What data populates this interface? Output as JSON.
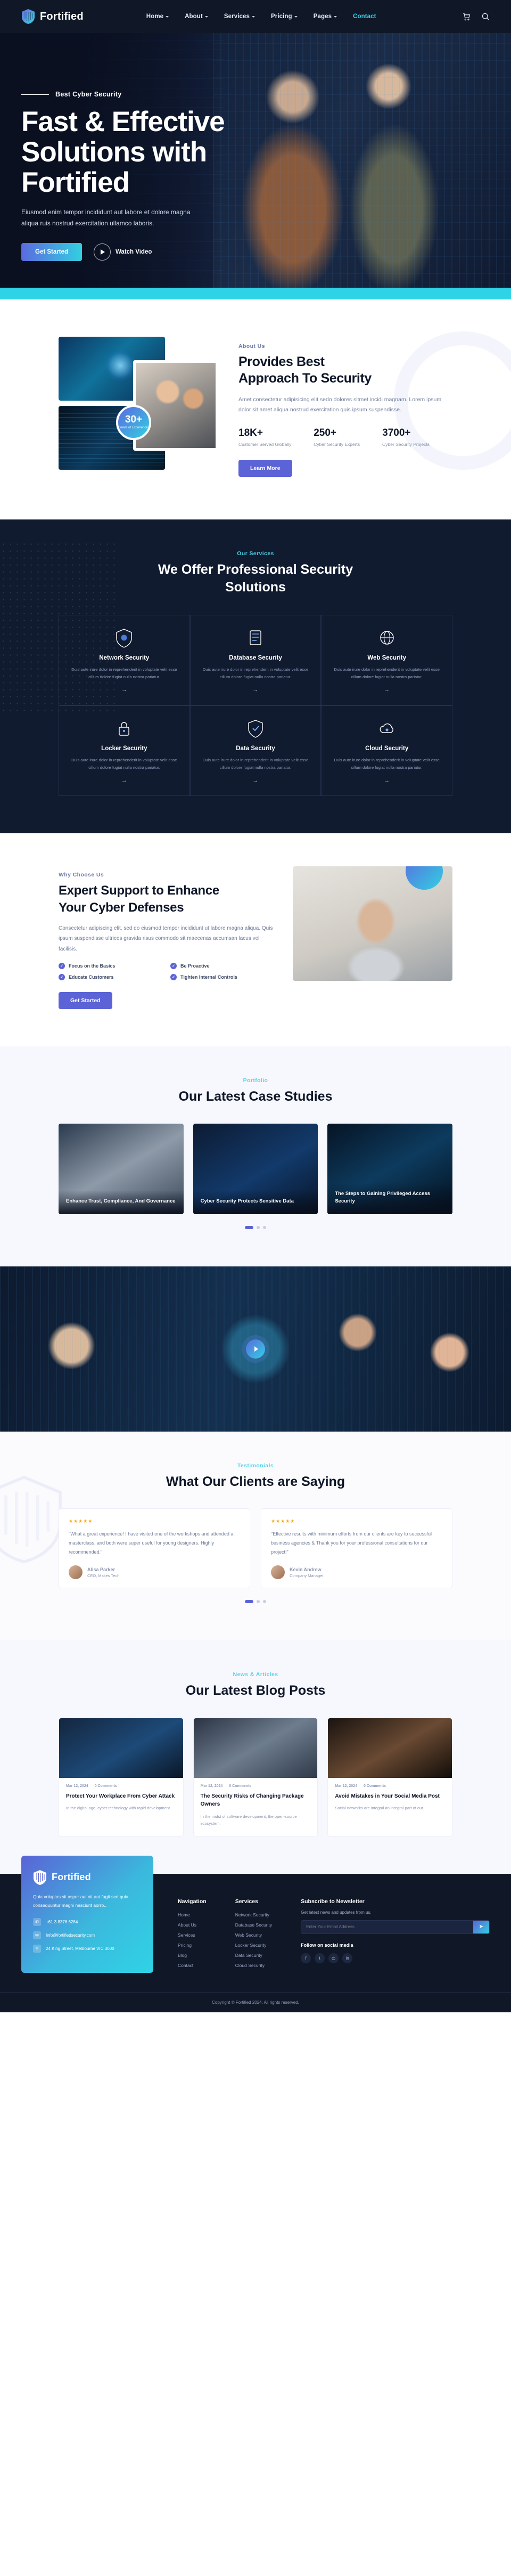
{
  "brand": {
    "name": "Fortified"
  },
  "nav": {
    "items": [
      {
        "label": "Home",
        "caret": true,
        "active": false
      },
      {
        "label": "About",
        "caret": true,
        "active": false
      },
      {
        "label": "Services",
        "caret": true,
        "active": false
      },
      {
        "label": "Pricing",
        "caret": true,
        "active": false
      },
      {
        "label": "Pages",
        "caret": true,
        "active": false
      },
      {
        "label": "Contact",
        "caret": false,
        "active": true
      }
    ],
    "icons": [
      "cart-icon",
      "search-icon"
    ]
  },
  "hero": {
    "eyebrow": "Best Cyber Security",
    "title_line1": "Fast & Effective",
    "title_line2": "Solutions with",
    "title_line3": "Fortified",
    "paragraph": "Eiusmod enim tempor incididunt aut labore et dolore magna aliqua ruis nostrud exercitation ullamco laboris.",
    "cta_primary": "Get Started",
    "cta_secondary": "Watch Video"
  },
  "about": {
    "badge_number": "30+",
    "badge_text": "Years of Experience",
    "tagline": "About Us",
    "heading_line1": "Provides Best",
    "heading_line2": "Approach To Security",
    "paragraph": "Amet consectetur adipisicing elit sedo dolores sitmet incidi magnam. Lorem ipsum dolor sit amet aliqua nostrud exercitation quis ipsum suspendisse.",
    "stats": [
      {
        "value": "18K+",
        "label": "Customer Served Globally"
      },
      {
        "value": "250+",
        "label": "Cyber Security Experts"
      },
      {
        "value": "3700+",
        "label": "Cyber Security Projects"
      }
    ],
    "cta": "Learn More"
  },
  "services": {
    "tagline": "Our Services",
    "heading_line1": "We Offer Professional Security",
    "heading_line2": "Solutions",
    "cards": [
      {
        "icon": "shield-lock-icon",
        "title": "Network Security",
        "text": "Duis aute irure dolor in reprehenderit in voluptate velit esse cillum dolore fugiat nulla nostra pariatur.",
        "arrow": "→"
      },
      {
        "icon": "database-icon",
        "title": "Database Security",
        "text": "Duis aute irure dolor in reprehenderit in voluptate velit esse cillum dolore fugiat nulla nostra pariatur.",
        "arrow": "→"
      },
      {
        "icon": "globe-icon",
        "title": "Web Security",
        "text": "Duis aute irure dolor in reprehenderit in voluptate velit esse cillum dolore fugiat nulla nostra pariatur.",
        "arrow": "→"
      },
      {
        "icon": "locker-icon",
        "title": "Locker Security",
        "text": "Duis aute irure dolor in reprehenderit in voluptate velit esse cillum dolore fugiat nulla nostra pariatur.",
        "arrow": "→"
      },
      {
        "icon": "data-shield-icon",
        "title": "Data Security",
        "text": "Duis aute irure dolor in reprehenderit in voluptate velit esse cillum dolore fugiat nulla nostra pariatur.",
        "arrow": "→"
      },
      {
        "icon": "cloud-icon",
        "title": "Cloud Security",
        "text": "Duis aute irure dolor in reprehenderit in voluptate velit esse cillum dolore fugiat nulla nostra pariatur.",
        "arrow": "→"
      }
    ]
  },
  "expert": {
    "tagline": "Why Choose Us",
    "heading_line1": "Expert Support to Enhance",
    "heading_line2": "Your Cyber Defenses",
    "paragraph": "Consectetur adipiscing elit, sed do eiusmod tempor incididunt ut labore magna aliqua. Quis ipsum suspendisse ultrices gravida risus commodo sit maecenas accumsan lacus vel facilisis.",
    "checks": [
      "Focus on the Basics",
      "Be Proactive",
      "Educate Customers",
      "Tighten Internal Controls"
    ],
    "cta": "Get Started"
  },
  "cases": {
    "tagline": "Portfolio",
    "heading": "Our Latest Case Studies",
    "items": [
      {
        "title": "Enhance Trust, Compliance, And Governance"
      },
      {
        "title": "Cyber Security Protects Sensitive Data"
      },
      {
        "title": "The Steps to Gaining Privileged Access Security"
      }
    ],
    "dots": 3,
    "active_dot": 1
  },
  "testimonials": {
    "tagline": "Testimonials",
    "heading": "What Our Clients are Saying",
    "items": [
      {
        "stars": "★★★★★",
        "quote": "\"What a great experience! I have visited one of the workshops and attended a masterclass, and both were super useful for young designers. Highly recommended.\"",
        "name": "Alisa Parker",
        "role": "CEO, Makes Tech"
      },
      {
        "stars": "★★★★★",
        "quote": "\"Effective results with minimum efforts from our clients are key to successful business agencies & Thank you for your professional consultations for our project!\"",
        "name": "Kevin Andrew",
        "role": "Company Manager"
      }
    ],
    "dots": 3,
    "active_dot": 1
  },
  "blog": {
    "tagline": "News & Articles",
    "heading": "Our Latest Blog Posts",
    "posts": [
      {
        "date": "Mar 12, 2024",
        "comments": "0 Comments",
        "title": "Protect Your Workplace From Cyber Attack",
        "excerpt": "In the digital age, cyber technology with rapid development."
      },
      {
        "date": "Mar 12, 2024",
        "comments": "0 Comments",
        "title": "The Security Risks of Changing Package Owners",
        "excerpt": "In the midst of software development, the open-source ecosystem."
      },
      {
        "date": "Mar 12, 2024",
        "comments": "0 Comments",
        "title": "Avoid Mistakes in Your Social Media Post",
        "excerpt": "Social networks are integral an integral part of our."
      }
    ]
  },
  "footer": {
    "description": "Quia voluptas sit asper aut oit aut fugit sed quia consequuntur magni nesciunt aorro..",
    "contacts": [
      {
        "icon": "phone-icon",
        "text": "+61 3 8376 6284"
      },
      {
        "icon": "mail-icon",
        "text": "Info@fortifiedsecurity.com"
      },
      {
        "icon": "pin-icon",
        "text": "24 King Street, Melbourne VIC 3000"
      }
    ],
    "columns": [
      {
        "title": "Navigation",
        "links": [
          "Home",
          "About Us",
          "Services",
          "Pricing",
          "Blog",
          "Contact"
        ]
      },
      {
        "title": "Services",
        "links": [
          "Network Security",
          "Database Security",
          "Web Security",
          "Locker Security",
          "Data Security",
          "Cloud Security"
        ]
      }
    ],
    "newsletter": {
      "title": "Subscribe to Newsletter",
      "text": "Get latest news and updates from us.",
      "placeholder": "Enter Your Email Address",
      "button": "➤"
    },
    "follow_label": "Follow on social media",
    "socials": [
      "facebook-icon",
      "twitter-icon",
      "instagram-icon",
      "linkedin-icon"
    ],
    "copyright": "Copyright © Fortified 2024. All rights reserved."
  }
}
